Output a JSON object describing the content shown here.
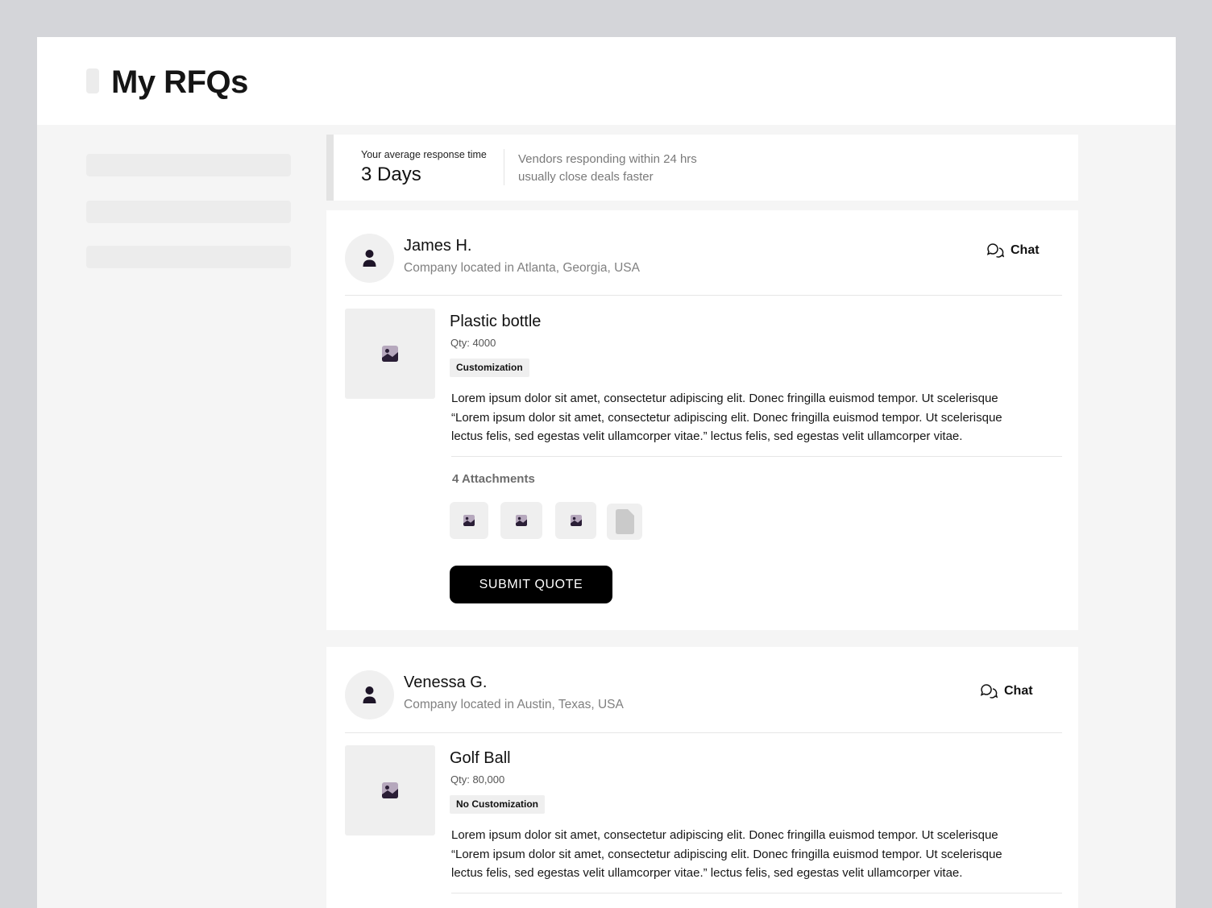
{
  "page": {
    "title": "My RFQs"
  },
  "stats": {
    "label": "Your average response time",
    "value": "3 Days",
    "tip": "Vendors responding within 24 hrs usually close deals faster"
  },
  "rfqs": [
    {
      "buyer_name": "James H.",
      "buyer_location": "Company located in Atlanta, Georgia, USA",
      "chat_label": "Chat",
      "product_name": "Plastic bottle",
      "qty": "Qty: 4000",
      "tag": "Customization",
      "description": "Lorem ipsum dolor sit amet, consectetur adipiscing elit. Donec fringilla euismod tempor. Ut scelerisque “Lorem ipsum dolor sit amet, consectetur adipiscing elit. Donec fringilla euismod tempor. Ut scelerisque lectus felis, sed egestas velit ullamcorper vitae.” lectus felis, sed egestas velit ullamcorper vitae.",
      "attachments_title": "4 Attachments",
      "attachments": [
        "image-icon",
        "image-icon",
        "image-icon",
        "file-icon"
      ],
      "submit_label": "SUBMIT QUOTE"
    },
    {
      "buyer_name": "Venessa G.",
      "buyer_location": "Company located in Austin, Texas, USA",
      "chat_label": "Chat",
      "product_name": "Golf Ball",
      "qty": "Qty: 80,000",
      "tag": "No Customization",
      "description": "Lorem ipsum dolor sit amet, consectetur adipiscing elit. Donec fringilla euismod tempor. Ut scelerisque “Lorem ipsum dolor sit amet, consectetur adipiscing elit. Donec fringilla euismod tempor. Ut scelerisque lectus felis, sed egestas velit ullamcorper vitae.” lectus felis, sed egestas velit ullamcorper vitae."
    }
  ],
  "colors": {
    "background": "#d4d5d9",
    "surface": "#ffffff",
    "canvas": "#f5f5f5",
    "primary_button": "#000000",
    "muted_text": "#808080",
    "icon_accent": "#2a1e36"
  }
}
